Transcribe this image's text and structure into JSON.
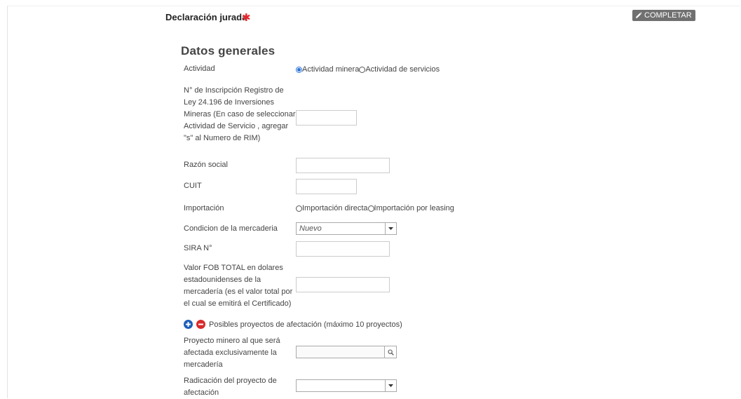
{
  "header": {
    "title": "Declaración jurada",
    "required_mark": "✱",
    "complete_label": "COMPLETAR"
  },
  "section": {
    "title": "Datos generales"
  },
  "form": {
    "actividad": {
      "label": "Actividad",
      "options": [
        "Actividad minera",
        "Actividad de servicios"
      ],
      "selected": "Actividad minera"
    },
    "inscripcion": {
      "label": "N° de Inscripción Registro de Ley 24.196 de Inversiones Mineras (En caso de seleccionar Actividad de Servicio , agregar \"s\" al Numero de RIM)",
      "value": ""
    },
    "razon_social": {
      "label": "Razón social",
      "value": ""
    },
    "cuit": {
      "label": "CUIT",
      "value": ""
    },
    "importacion": {
      "label": "Importación",
      "options": [
        "Importación directa",
        "Importación por leasing"
      ],
      "selected": ""
    },
    "condicion": {
      "label": "Condicion de la mercaderia",
      "selected": "Nuevo"
    },
    "sira": {
      "label": "SIRA N°",
      "value": ""
    },
    "valor_fob": {
      "label": "Valor FOB TOTAL en dolares estadounidenses de la mercadería (es el valor total por el cual se emitirá el Certificado)",
      "value": ""
    },
    "proyectos": {
      "label": "Posibles proyectos de afectación (máximo 10 proyectos)"
    },
    "proyecto_minero": {
      "label": "Proyecto minero al que será afectada exclusivamente la mercadería",
      "value": ""
    },
    "radicacion": {
      "label": "Radicación del proyecto de afectación",
      "selected": ""
    }
  },
  "colors": {
    "required": "#e8262b",
    "button_bg": "#707070",
    "radio_checked": "#2a72d9",
    "add_button": "#1c5fb8",
    "remove_button": "#d92a2a"
  }
}
